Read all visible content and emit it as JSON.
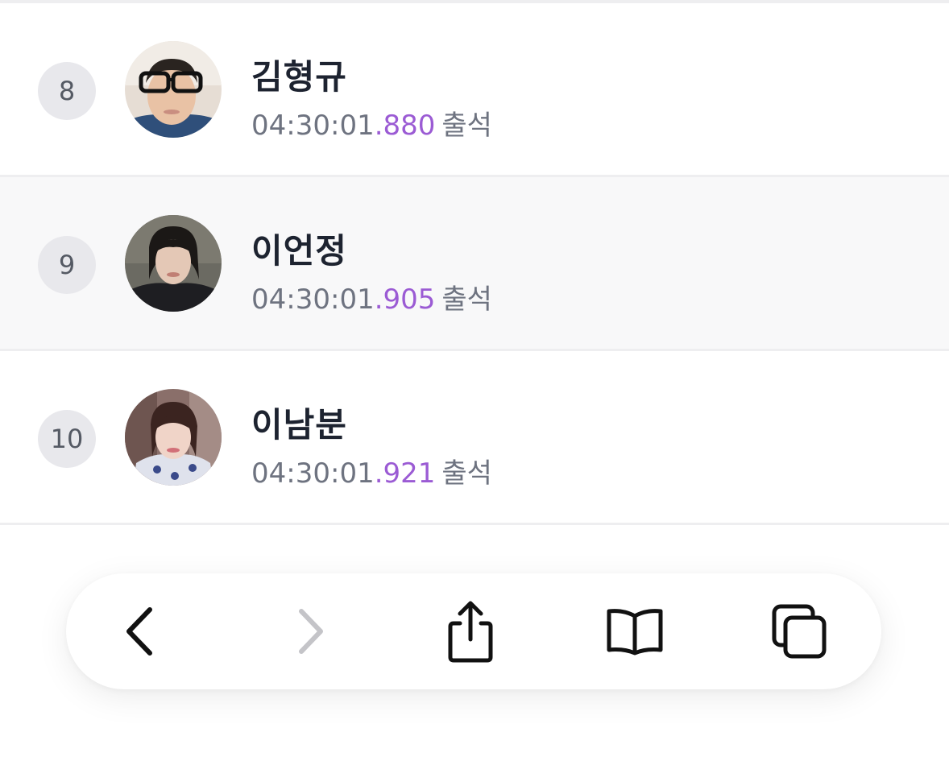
{
  "attendance": [
    {
      "rank": "8",
      "name": "김형규",
      "time_main": "04:30:01",
      "time_ms": ".880",
      "status": "출석"
    },
    {
      "rank": "9",
      "name": "이언정",
      "time_main": "04:30:01",
      "time_ms": ".905",
      "status": "출석"
    },
    {
      "rank": "10",
      "name": "이남분",
      "time_main": "04:30:01",
      "time_ms": ".921",
      "status": "출석"
    }
  ],
  "toolbar": {
    "icons": [
      "back-icon",
      "forward-icon",
      "share-icon",
      "bookmarks-icon",
      "tabs-icon"
    ]
  },
  "colors": {
    "accent": "#9b5bd4",
    "text_primary": "#1d2330",
    "text_secondary": "#6e7380",
    "rank_bg": "#e8e8ec",
    "alt_row_bg": "#f8f8f9"
  }
}
